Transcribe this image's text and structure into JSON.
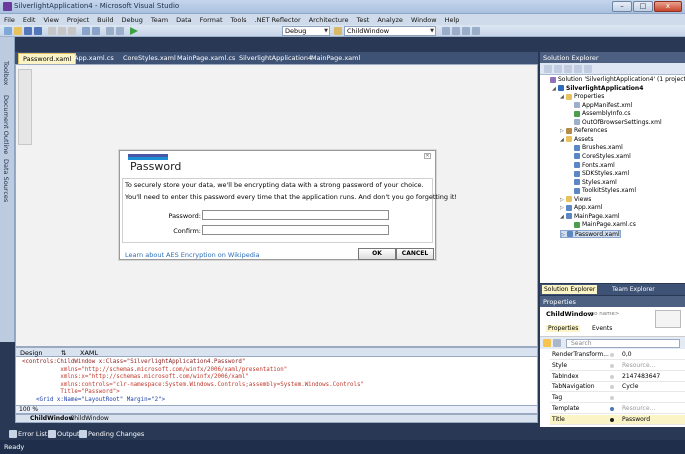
{
  "window": {
    "title": "SilverlightApplication4 - Microsoft Visual Studio",
    "minimize": "–",
    "maximize": "□",
    "close": "x"
  },
  "menu": [
    "File",
    "Edit",
    "View",
    "Project",
    "Build",
    "Debug",
    "Team",
    "Data",
    "Format",
    "Tools",
    ".NET Reflector",
    "Architecture",
    "Test",
    "Analyze",
    "Window",
    "Help"
  ],
  "toolbar": {
    "config": "Debug",
    "find_target": "ChildWindow"
  },
  "left_strip": {
    "toolbox": "Toolbox",
    "document_outline": "Document Outline",
    "data_sources": "Data Sources"
  },
  "doc_tabs": [
    "Password.xaml",
    "App.xaml.cs",
    "CoreStyles.xaml",
    "MainPage.xaml.cs",
    "SilverlightApplication4",
    "MainPage.xaml"
  ],
  "dialog": {
    "title": "Password",
    "line1": "To securely store your data, we'll be encrypting data with a strong password of your choice.",
    "line2": "You'll need to enter this password every time that the application runs. And don't you go forgetting it!",
    "password_label": "Password:",
    "confirm_label": "Confirm:",
    "link": "Learn about AES Encryption on Wikipedia",
    "ok": "OK",
    "cancel": "CANCEL"
  },
  "split_bar": {
    "design": "Design",
    "swap": "⇅",
    "xaml": "XAML"
  },
  "xaml_lines": [
    "<controls:ChildWindow x:Class=\"SilverlightApplication4.Password\"",
    "           xmlns=\"http://schemas.microsoft.com/winfx/2006/xaml/presentation\"",
    "           xmlns:x=\"http://schemas.microsoft.com/winfx/2006/xaml\"",
    "           xmlns:controls=\"clr-namespace:System.Windows.Controls;assembly=System.Windows.Controls\"",
    "           Title=\"Password\">",
    "    <Grid x:Name=\"LayoutRoot\" Margin=\"2\">"
  ],
  "xaml_status": {
    "zoom": "100 %"
  },
  "breadcrumb": {
    "root": "ChildWindow",
    "current": "ChildWindow"
  },
  "solution_explorer": {
    "title": "Solution Explorer",
    "items": [
      {
        "label": "Solution 'SilverlightApplication4' (1 project)",
        "level": 0,
        "kind": "solution",
        "expander": ""
      },
      {
        "label": "SilverlightApplication4",
        "level": 1,
        "kind": "project",
        "expander": "◢",
        "bold": true
      },
      {
        "label": "Properties",
        "level": 2,
        "kind": "folder",
        "expander": "◢"
      },
      {
        "label": "AppManifest.xml",
        "level": 3,
        "kind": "file",
        "expander": ""
      },
      {
        "label": "AssemblyInfo.cs",
        "level": 3,
        "kind": "cs",
        "expander": ""
      },
      {
        "label": "OutOfBrowserSettings.xml",
        "level": 3,
        "kind": "file",
        "expander": ""
      },
      {
        "label": "References",
        "level": 2,
        "kind": "ref",
        "expander": "▷"
      },
      {
        "label": "Assets",
        "level": 2,
        "kind": "folder",
        "expander": "◢"
      },
      {
        "label": "Brushes.xaml",
        "level": 3,
        "kind": "xaml",
        "expander": ""
      },
      {
        "label": "CoreStyles.xaml",
        "level": 3,
        "kind": "xaml",
        "expander": ""
      },
      {
        "label": "Fonts.xaml",
        "level": 3,
        "kind": "xaml",
        "expander": ""
      },
      {
        "label": "SDKStyles.xaml",
        "level": 3,
        "kind": "xaml",
        "expander": ""
      },
      {
        "label": "Styles.xaml",
        "level": 3,
        "kind": "xaml",
        "expander": ""
      },
      {
        "label": "ToolkitStyles.xaml",
        "level": 3,
        "kind": "xaml",
        "expander": ""
      },
      {
        "label": "Views",
        "level": 2,
        "kind": "folder",
        "expander": "▷"
      },
      {
        "label": "App.xaml",
        "level": 2,
        "kind": "xaml",
        "expander": "▷"
      },
      {
        "label": "MainPage.xaml",
        "level": 2,
        "kind": "xaml",
        "expander": "◢"
      },
      {
        "label": "MainPage.xaml.cs",
        "level": 3,
        "kind": "cs",
        "expander": ""
      },
      {
        "label": "Password.xaml",
        "level": 2,
        "kind": "xaml",
        "expander": "▷",
        "selected": true
      }
    ],
    "tab_solution": "Solution Explorer",
    "tab_team": "Team Explorer"
  },
  "properties": {
    "title": "Properties",
    "type": "ChildWindow",
    "name_placeholder": "<no name>",
    "tab_props": "Properties",
    "tab_events": "Events",
    "search_placeholder": "Search",
    "rows": [
      {
        "name": "RenderTransform...",
        "value": "0,0",
        "dot": "#d0d0d0"
      },
      {
        "name": "Style",
        "value": "Resource...",
        "dot": "#d0d0d0",
        "muted": true
      },
      {
        "name": "TabIndex",
        "value": "2147483647",
        "dot": "#d0d0d0"
      },
      {
        "name": "TabNavigation",
        "value": "Cycle",
        "dot": "#d0d0d0"
      },
      {
        "name": "Tag",
        "value": "",
        "dot": "#d0d0d0"
      },
      {
        "name": "Template",
        "value": "Resource...",
        "dot": "#4b75b8",
        "muted": true
      },
      {
        "name": "Title",
        "value": "Password",
        "dot": "#1b1b1b",
        "selected": true
      }
    ]
  },
  "bottom_tabs": [
    "Error List",
    "Output",
    "Pending Changes"
  ],
  "status": "Ready",
  "colors": {
    "accent": "#1c8fd5",
    "link": "#2c6fb5",
    "chrome": "#293955"
  }
}
